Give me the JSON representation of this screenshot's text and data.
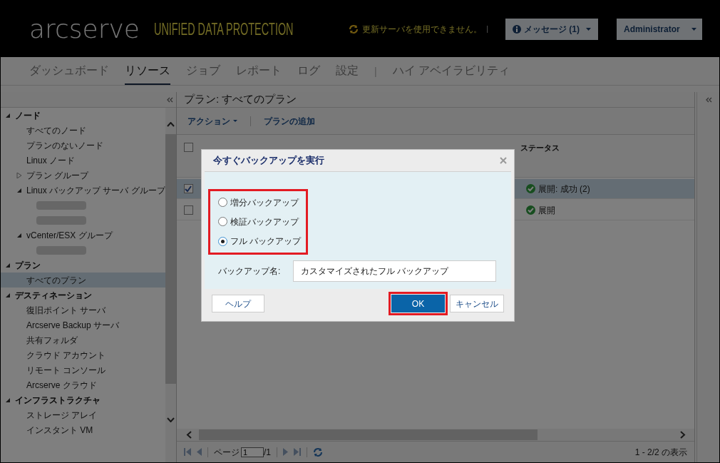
{
  "header": {
    "logo": "arcserve",
    "product": "UNIFIED DATA PROTECTION",
    "notice": "更新サーバを使用できません。",
    "separator": "|",
    "messages_button": "メッセージ (1)",
    "user_button": "Administrator"
  },
  "nav": {
    "tabs": [
      {
        "label": "ダッシュボード",
        "selected": false
      },
      {
        "label": "リソース",
        "selected": true
      },
      {
        "label": "ジョブ",
        "selected": false
      },
      {
        "label": "レポート",
        "selected": false
      },
      {
        "label": "ログ",
        "selected": false
      },
      {
        "label": "設定",
        "selected": false
      }
    ],
    "separator": "|",
    "extra_tab": "ハイ アベイラビリティ"
  },
  "sidebar": {
    "sections": [
      {
        "label": "ノード",
        "expanded": true,
        "items": [
          {
            "kind": "item",
            "label": "すべてのノード",
            "selected": false
          },
          {
            "kind": "item",
            "label": "プランのないノード",
            "selected": false
          },
          {
            "kind": "item",
            "label": "Linux ノード",
            "selected": false
          },
          {
            "kind": "group",
            "label": "プラン グループ",
            "expanded": false
          },
          {
            "kind": "group",
            "label": "Linux バックアップ サーバ グループ",
            "expanded": true,
            "children": [
              {
                "kind": "redacted"
              },
              {
                "kind": "redacted"
              }
            ]
          },
          {
            "kind": "group",
            "label": "vCenter/ESX グループ",
            "expanded": true,
            "children": [
              {
                "kind": "redacted"
              }
            ]
          }
        ]
      },
      {
        "label": "プラン",
        "expanded": true,
        "items": [
          {
            "kind": "item",
            "label": "すべてのプラン",
            "selected": true
          }
        ]
      },
      {
        "label": "デスティネーション",
        "expanded": true,
        "items": [
          {
            "kind": "item",
            "label": "復旧ポイント サーバ",
            "selected": false
          },
          {
            "kind": "item",
            "label": "Arcserve Backup サーバ",
            "selected": false
          },
          {
            "kind": "item",
            "label": "共有フォルダ",
            "selected": false
          },
          {
            "kind": "item",
            "label": "クラウド アカウント",
            "selected": false
          },
          {
            "kind": "item",
            "label": "リモート コンソール",
            "selected": false
          },
          {
            "kind": "item",
            "label": "Arcserve クラウド",
            "selected": false
          }
        ]
      },
      {
        "label": "インフラストラクチャ",
        "expanded": true,
        "items": [
          {
            "kind": "item",
            "label": "ストレージ アレイ",
            "selected": false
          },
          {
            "kind": "item",
            "label": "インスタント VM",
            "selected": false
          }
        ]
      }
    ]
  },
  "main": {
    "title": "プラン: すべてのプラン",
    "toolbar": {
      "action_menu": "アクション",
      "add_plan": "プランの追加"
    },
    "table": {
      "header_checked": false,
      "columns": [
        "ステータス"
      ],
      "rows": [
        {
          "checked": true,
          "selected": true,
          "status": "展開: 成功 (2)"
        },
        {
          "checked": false,
          "selected": false,
          "status": "展開"
        }
      ]
    },
    "pager": {
      "page_label": "ページ",
      "page": "1",
      "page_total": "/1",
      "summary": "1 - 2/2 の表示"
    }
  },
  "dialog": {
    "title": "今すぐバックアップを実行",
    "options_highlighted": true,
    "options": [
      {
        "label": "増分バックアップ",
        "selected": false
      },
      {
        "label": "検証バックアップ",
        "selected": false
      },
      {
        "label": "フル バックアップ",
        "selected": true
      }
    ],
    "name_label": "バックアップ名:",
    "name_value": "カスタマイズされたフル バックアップ",
    "help_button": "ヘルプ",
    "ok_button": {
      "label": "OK",
      "highlighted": true
    },
    "cancel_button": "キャンセル"
  }
}
